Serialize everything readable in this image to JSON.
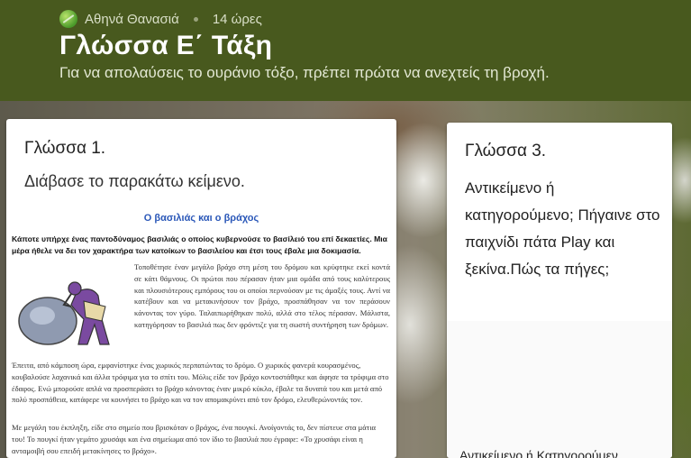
{
  "header": {
    "author": "Αθηνά Θανασιά",
    "duration": "14 ώρες",
    "title": "Γλώσσα Ε΄ Τάξη",
    "subtitle": "Για να απολαύσεις το ουράνιο τόξο, πρέπει πρώτα να ανεχτείς τη βροχή."
  },
  "card1": {
    "title": "Γλώσσα 1.",
    "prompt": "Διάβασε το παρακάτω κείμενο.",
    "doc": {
      "title": "Ο βασιλιάς και ο βράχος",
      "intro": "Κάποτε υπήρχε ένας παντοδύναμος βασιλιάς ο οποίος κυβερνούσε το βασίλειό του επί δεκαετίες. Μια μέρα ήθελε να δει τον χαρακτήρα των κατοίκων το βασιλείου και έτσι τους έβαλε μια δοκιμασία.",
      "p1": "Τοποθέτησε έναν μεγάλο βράχο στη μέση του δρόμου και κρύφτηκε εκεί κοντά σε κάτι θάμνους. Οι πρώτοι που πέρασαν ήταν μια ομάδα από τους καλύτερους και πλουσιότερους εμπόρους του οι οποίοι περνούσαν με τις άμαξές τους. Αντί να κατέβουν και να μετακινήσουν τον βράχο, προσπάθησαν να τον περάσουν κάνοντας τον γύρο. Ταλαιπωρήθηκαν πολύ, αλλά στο τέλος πέρασαν. Μάλιστα, κατηγόρησαν το βασιλιά πως δεν φρόντιζε για τη σωστή συντήρηση των δρόμων.",
      "p2": "Έπειτα, από κάμποση ώρα, εμφανίστηκε ένας χωρικός περπατώντας το δρόμο. Ο χωρικός φανερά κουρασμένος, κουβαλούσε λαχανικά και άλλα τρόφιμα για το σπίτι του. Μόλις είδε τον βράχο κοντοστάθηκε και άφησε τα τρόφιμα στο έδαφος. Ενώ μπορούσε απλά να προσπεράσει το βράχο κάνοντας έναν μικρό κύκλο, έβαλε τα δυνατά του και μετά από πολύ προσπάθεια, κατάφερε να κουνήσει το βράχο και να τον απομακρύνει από τον δρόμο, ελευθερώνοντάς τον.",
      "p3": "Με μεγάλη του έκπληξη, είδε στο σημείο που βρισκόταν ο βράχος, ένα πουγκί. Ανοίγοντάς το, δεν πίστευε στα μάτια του! Το πουγκί ήταν γεμάτο χρυσάφι και ένα σημείωμα από τον ίδιο το βασιλιά που έγραφε: «Το χρυσάφι είναι η ανταμοιβή σου επειδή μετακίνησες το βράχο»."
    }
  },
  "card3": {
    "title": "Γλώσσα 3.",
    "prompt": "Αντικείμενο ή κατηγορούμενο; Πήγαινε στο παιχνίδι πάτα Play και ξεκίνα.Πώς τα πήγες;",
    "footer": "Αντικείμενο ή Κατηγορούμεν"
  },
  "colors": {
    "header_bg": "#48591e",
    "doc_title": "#2a57b8"
  }
}
